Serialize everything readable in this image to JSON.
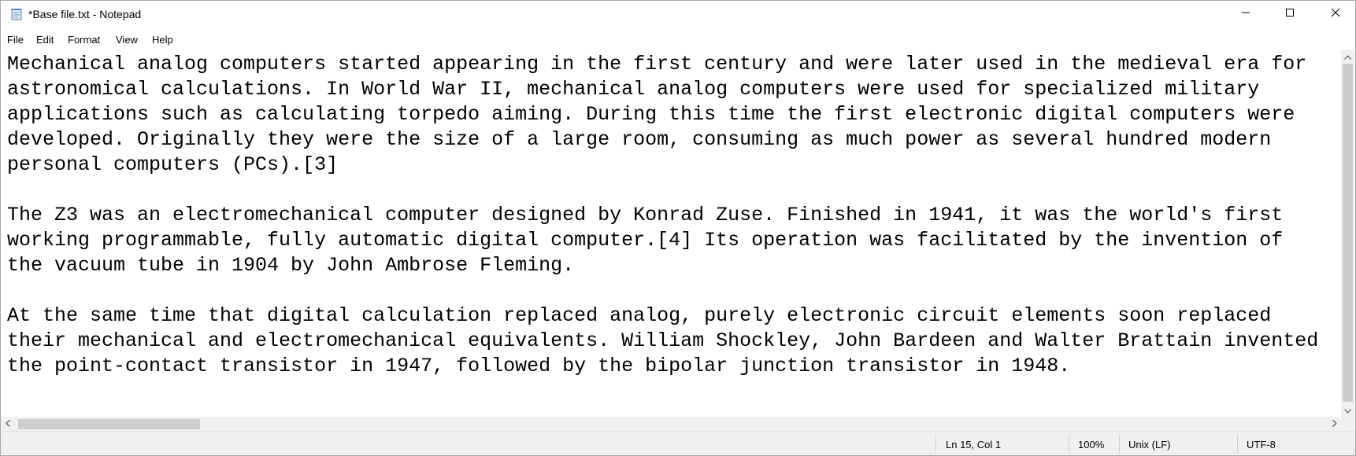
{
  "window": {
    "title": "*Base file.txt - Notepad"
  },
  "icons": {
    "app": "notepad-icon",
    "minimize": "minimize-icon",
    "maximize": "maximize-icon",
    "close": "close-icon"
  },
  "menu": {
    "file": "File",
    "edit": "Edit",
    "format": "Format",
    "view": "View",
    "help": "Help"
  },
  "document": {
    "lines": [
      "Mechanical analog computers started appearing in the first century and were later used in the medieval era for",
      "astronomical calculations. In World War II, mechanical analog computers were used for specialized military",
      "applications such as calculating torpedo aiming. During this time the first electronic digital computers were",
      "developed. Originally they were the size of a large room, consuming as much power as several hundred modern",
      "personal computers (PCs).[3]",
      "",
      "The Z3 was an electromechanical computer designed by Konrad Zuse. Finished in 1941, it was the world's first",
      "working programmable, fully automatic digital computer.[4] Its operation was facilitated by the invention of",
      "the vacuum tube in 1904 by John Ambrose Fleming.",
      "",
      "At the same time that digital calculation replaced analog, purely electronic circuit elements soon replaced",
      "their mechanical and electromechanical equivalents. William Shockley, John Bardeen and Walter Brattain invented",
      "the point-contact transistor in 1947, followed by the bipolar junction transistor in 1948."
    ]
  },
  "status": {
    "position": "Ln 15, Col 1",
    "zoom": "100%",
    "line_ending": "Unix (LF)",
    "encoding": "UTF-8"
  }
}
